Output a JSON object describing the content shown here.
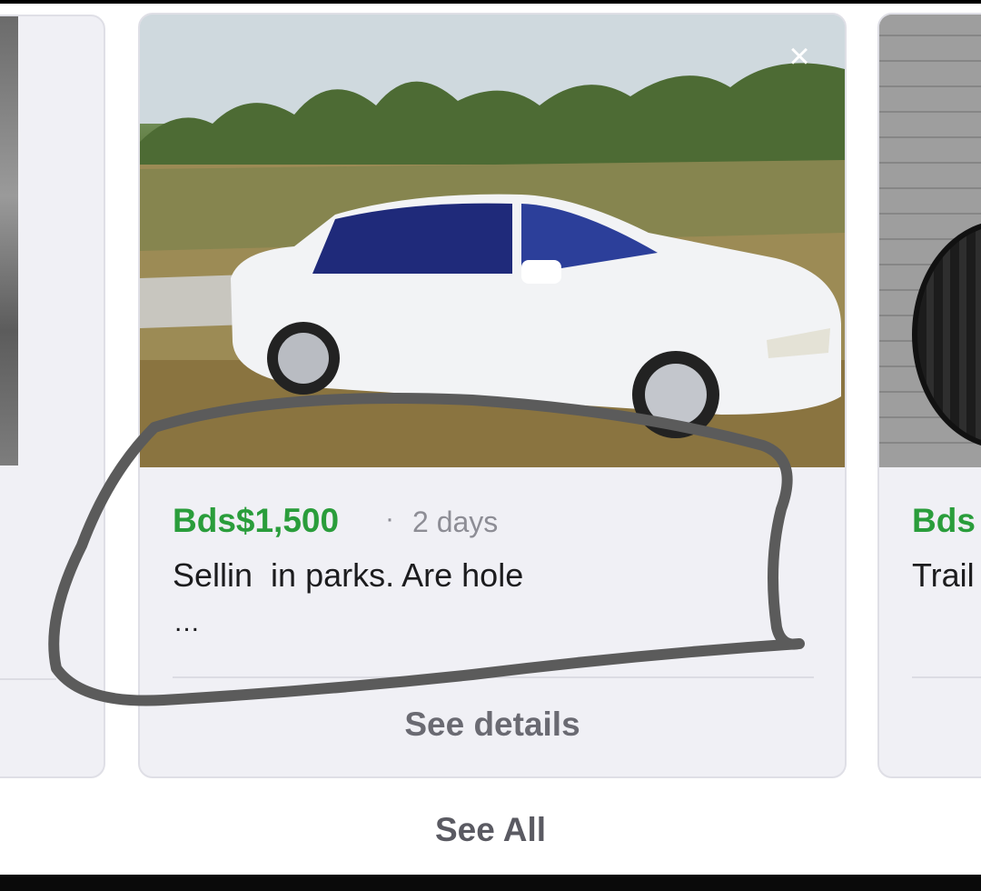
{
  "listing": {
    "price": "Bds$1,500",
    "separator": "·",
    "age": "2 days",
    "title": "Sellin  in parks. Are hole",
    "ellipsis": "...",
    "details_label": "See details",
    "close_icon": "×"
  },
  "next_listing": {
    "price_partial": "Bds",
    "title_partial": "Trail"
  },
  "footer": {
    "see_all_label": "See All"
  },
  "colors": {
    "price": "#2a9d3b",
    "muted_text": "#8d8d95",
    "card_bg": "#f0f0f5",
    "annotation_stroke": "#5b5b5b"
  }
}
